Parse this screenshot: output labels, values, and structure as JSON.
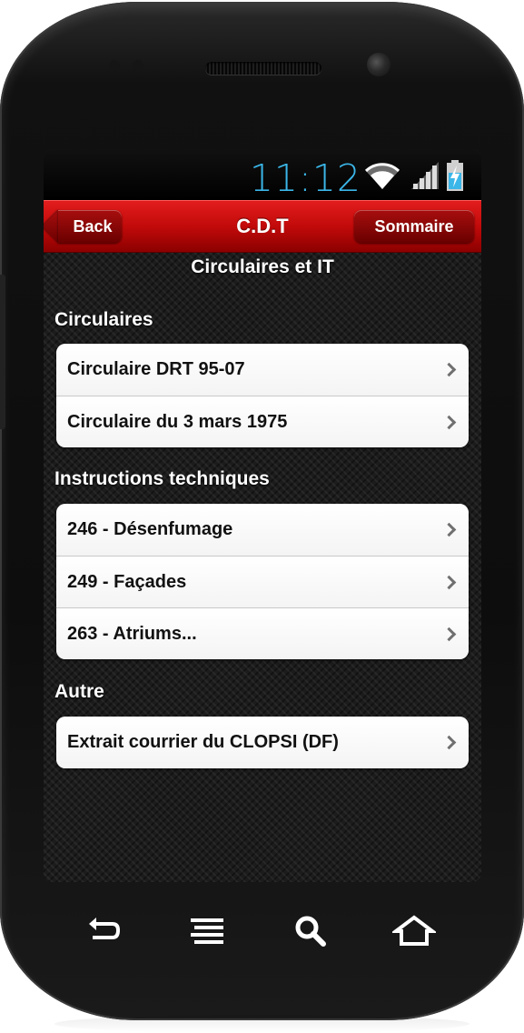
{
  "status_bar": {
    "time": "11:12",
    "icons": [
      "wifi-icon",
      "signal-icon",
      "battery-charging-icon"
    ],
    "clock_color": "#3bb6e8"
  },
  "header": {
    "back_label": "Back",
    "title": "C.D.T",
    "sommaire_label": "Sommaire",
    "accent_color": "#c20a0a"
  },
  "page_title": "Circulaires et IT",
  "sections": [
    {
      "label": "Circulaires",
      "items": [
        {
          "label": "Circulaire DRT 95-07"
        },
        {
          "label": "Circulaire du 3 mars 1975"
        }
      ]
    },
    {
      "label": "Instructions techniques",
      "items": [
        {
          "label": "246 - Désenfumage"
        },
        {
          "label": "249 - Façades"
        },
        {
          "label": "263 - Atriums..."
        }
      ]
    },
    {
      "label": "Autre",
      "items": [
        {
          "label": "Extrait courrier du CLOPSI (DF)"
        }
      ]
    }
  ],
  "softkeys": [
    "back-arrow-icon",
    "menu-icon",
    "search-icon",
    "home-icon"
  ]
}
